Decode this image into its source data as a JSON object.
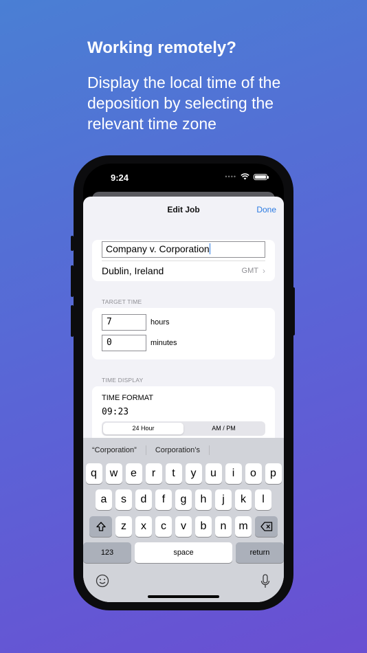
{
  "promo": {
    "headline": "Working remotely?",
    "subline": "Display the local time of the deposition by selecting the relevant time zone"
  },
  "status_bar": {
    "time": "9:24"
  },
  "nav": {
    "title": "Edit Job",
    "done_label": "Done"
  },
  "job": {
    "name_value": "Company v. Corporation",
    "location": "Dublin, Ireland",
    "timezone_abbrev": "GMT"
  },
  "target_time": {
    "header": "TARGET TIME",
    "hours_value": "7",
    "hours_label": "hours",
    "minutes_value": "0",
    "minutes_label": "minutes"
  },
  "time_display": {
    "header": "TIME DISPLAY",
    "format_label": "TIME FORMAT",
    "preview": "09:23",
    "segments": [
      "24 Hour",
      "AM / PM"
    ],
    "selected_segment": "24 Hour"
  },
  "keyboard": {
    "suggestions": [
      "“Corporation”",
      "Corporation’s",
      ""
    ],
    "row1": [
      "q",
      "w",
      "e",
      "r",
      "t",
      "y",
      "u",
      "i",
      "o",
      "p"
    ],
    "row2": [
      "a",
      "s",
      "d",
      "f",
      "g",
      "h",
      "j",
      "k",
      "l"
    ],
    "row3": [
      "z",
      "x",
      "c",
      "v",
      "b",
      "n",
      "m"
    ],
    "numbers_label": "123",
    "space_label": "space",
    "return_label": "return"
  },
  "colors": {
    "accent": "#2a7ae2",
    "background_top": "#4a7fd4",
    "background_bottom": "#6a4fd2"
  }
}
